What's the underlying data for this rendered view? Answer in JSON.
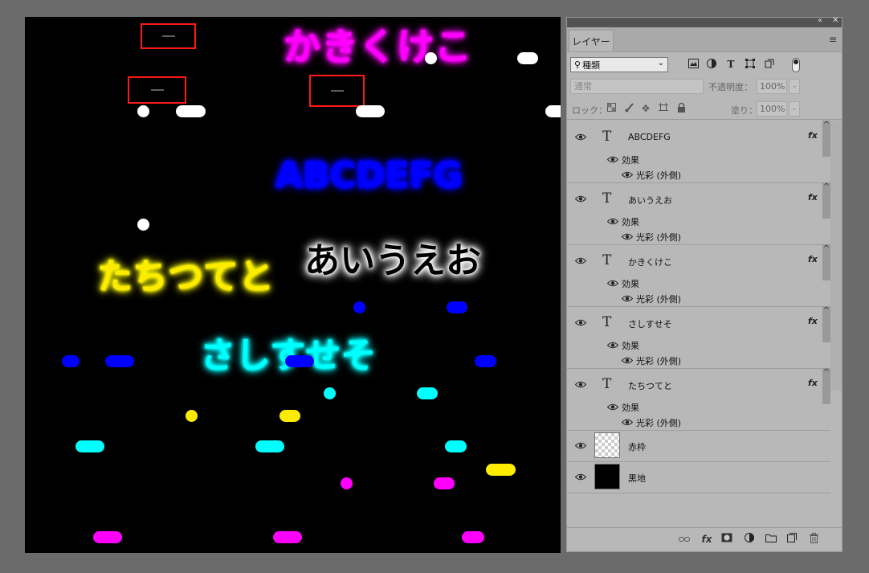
{
  "canvas": {
    "texts": {
      "kakikukeko": "かきくけこ",
      "abc": "ABCDEFG",
      "aiueo": "あいうえお",
      "tachitsu": "たちつてと",
      "sashisu": "さしすせそ"
    }
  },
  "panel": {
    "collapse_glyph": "«",
    "close_glyph": "✕",
    "tab": "レイヤー",
    "menu_glyph": "≡",
    "filter": {
      "label": "種類",
      "search_glyph": "⚲",
      "chevron": "⌄"
    },
    "blend": {
      "mode": "通常",
      "opacity_label": "不透明度：",
      "opacity": "100%"
    },
    "lock": {
      "label": "ロック：",
      "fill_label": "塗り：",
      "fill": "100%"
    },
    "layers": [
      {
        "name": "ABCDEFG",
        "type": "T",
        "fx": "fx",
        "effects": "効果",
        "effect": "光彩 (外側)"
      },
      {
        "name": "あいうえお",
        "type": "T",
        "fx": "fx",
        "effects": "効果",
        "effect": "光彩 (外側)"
      },
      {
        "name": "かきくけこ",
        "type": "T",
        "fx": "fx",
        "effects": "効果",
        "effect": "光彩 (外側)"
      },
      {
        "name": "さしすせそ",
        "type": "T",
        "fx": "fx",
        "effects": "効果",
        "effect": "光彩 (外側)"
      },
      {
        "name": "たちつてと",
        "type": "T",
        "fx": "fx",
        "effects": "効果",
        "effect": "光彩 (外側)"
      },
      {
        "name": "赤枠"
      },
      {
        "name": "黒地"
      }
    ]
  },
  "colors": {
    "magenta": "#ff00ff",
    "blue": "#0000ff",
    "white": "#ffffff",
    "yellow": "#ffeb00",
    "cyan": "#00ffff",
    "red": "#ff1a1a"
  }
}
